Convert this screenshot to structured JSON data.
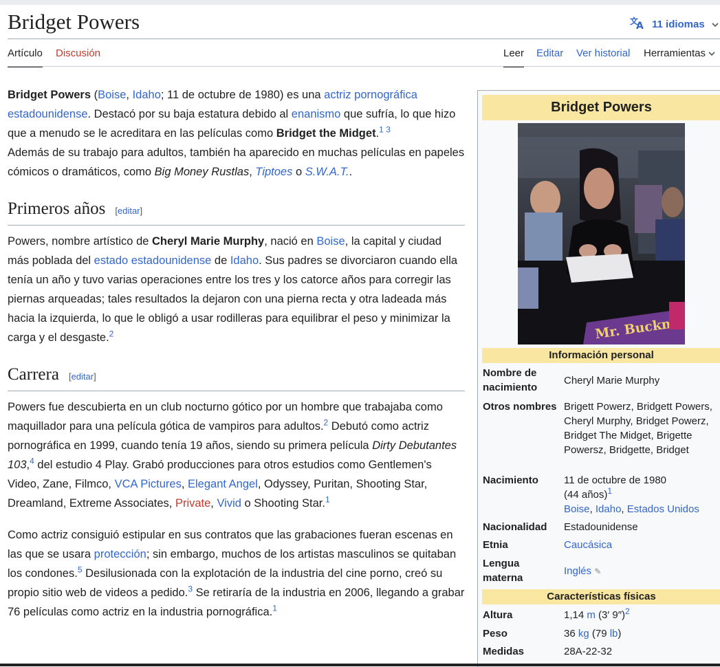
{
  "page": {
    "title": "Bridget Powers",
    "languages_label": "11 idiomas"
  },
  "tabs": {
    "article": "Artículo",
    "talk": "Discusión",
    "read": "Leer",
    "edit": "Editar",
    "history": "Ver historial",
    "tools": "Herramientas"
  },
  "article": {
    "intro": {
      "name": "Bridget Powers",
      "t1": " (",
      "boise": "Boise",
      "comma": ", ",
      "idaho": "Idaho",
      "t2": "; 11 de octubre de 1980) es una ",
      "link_actriz": "actriz pornográfica estadounidense",
      "t3": ". Destacó por su baja estatura debido al ",
      "link_enanismo": "enanismo",
      "t4": " que sufría, lo que hizo que a menudo se le acreditara en las películas como ",
      "midget": "Bridget the Midget",
      "dot": ".",
      "ref1": "1",
      "ref3": "3",
      "t5": "Además de su trabajo para adultos, también ha aparecido en muchas películas en papeles cómicos o dramáticos, como ",
      "film1": "Big Money Rustlas",
      "sep1": ", ",
      "film2": "Tiptoes",
      "sep2": " o ",
      "film3": "S.W.A.T.",
      "end": "."
    },
    "edit_open": "[",
    "edit_label": "editar",
    "edit_close": "]",
    "section1": {
      "heading": "Primeros años",
      "t1": "Powers, nombre artístico de ",
      "name": "Cheryl Marie Murphy",
      "t2": ", nació en ",
      "boise": "Boise",
      "t3": ", la capital y ciudad más poblada del ",
      "estado": "estado estadounidense",
      "t4": " de ",
      "idaho": "Idaho",
      "t5": ". Sus padres se divorciaron cuando ella tenía un año y tuvo varias operaciones entre los tres y los catorce años para corregir las piernas arqueadas; tales resultados la dejaron con una pierna recta y otra ladeada más hacia la izquierda, lo que le obligó a usar rodilleras para equilibrar el peso y minimizar la carga y el desgaste.",
      "ref": "2"
    },
    "section2": {
      "heading": "Carrera",
      "p1": {
        "t1": "Powers fue descubierta en un club nocturno gótico por un hombre que trabajaba como maquillador para una película gótica de vampiros para adultos.",
        "ref_a": "2",
        "t2": " Debutó como actriz pornográfica en 1999, cuando tenía 19 años, siendo su primera película ",
        "film": "Dirty Debutantes 103",
        "comma": ",",
        "ref_b": "4",
        "t3": " del estudio 4 Play. Grabó producciones para otros estudios como Gentlemen's Video, Zane, Filmco, ",
        "vca": "VCA Pictures",
        "c1": ", ",
        "elegant": "Elegant Angel",
        "t4": ", Odyssey, Puritan, Shooting Star, Dreamland, Extreme Associates, ",
        "private": "Private",
        "c2": ", ",
        "vivid": "Vivid",
        "t5": " o Shooting Star.",
        "ref_c": "1"
      },
      "p2": {
        "t1": "Como actriz consiguió estipular en sus contratos que las grabaciones fueran escenas en las que se usara ",
        "proteccion": "protección",
        "t2": "; sin embargo, muchos de los artistas masculinos se quitaban los condones.",
        "ref_a": "5",
        "t3": " Desilusionada con la explotación de la industria del cine porno, creó su propio sitio web de videos a pedido.",
        "ref_b": "3",
        "t4": " Se retiraría de la industria en 2006, llegando a grabar 76 películas como actriz en la industria pornográfica.",
        "ref_c": "1"
      }
    }
  },
  "infobox": {
    "title": "Bridget Powers",
    "section_personal": "Información personal",
    "section_physical": "Características físicas",
    "rows": {
      "birth_name": {
        "label": "Nombre de nacimiento",
        "value": "Cheryl Marie Murphy"
      },
      "other_names": {
        "label": "Otros nombres",
        "value": "Brigett Powerz, Bridgett Powers, Cheryl Murphy, Bridget Powerz, Bridget The Midget, Brigette Powersz, Bridgette, Bridget"
      },
      "birth": {
        "label": "Nacimiento",
        "date": "11 de octubre de 1980",
        "age": "(44 años)",
        "ref": "1",
        "boise": "Boise",
        "idaho": "Idaho",
        "country": "Estados Unidos",
        "comma": ", "
      },
      "nationality": {
        "label": "Nacionalidad",
        "value": "Estadounidense"
      },
      "ethnicity": {
        "label": "Etnia",
        "value": "Caucásica"
      },
      "mother_tongue": {
        "label": "Lengua materna",
        "value": "Inglés"
      },
      "height": {
        "label": "Altura",
        "num": "1,14",
        "unit": "m",
        "conv": " (3′ 9″)",
        "ref": "2"
      },
      "weight": {
        "label": "Peso",
        "num": "36",
        "unit": "kg",
        "conv_open": " (79 ",
        "conv_unit": "lb",
        "conv_close": ")"
      },
      "measurements": {
        "label": "Medidas",
        "value": "28A-22-32"
      }
    }
  },
  "photo": {
    "poster_text": "Mr. Buckmore"
  }
}
